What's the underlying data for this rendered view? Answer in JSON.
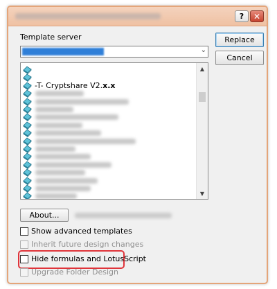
{
  "dialog": {
    "help_label": "?",
    "close_label": "✕",
    "template_server_label": "Template server",
    "replace_label": "Replace",
    "cancel_label": "Cancel",
    "about_label": "About...",
    "template_list": {
      "visible_item": "-T- Cryptshare V2.",
      "visible_item_suffix": "x.x",
      "selected_index": 2,
      "icon": "notes-database-book-icon"
    },
    "options": {
      "show_advanced_templates": {
        "label": "Show advanced templates",
        "checked": false,
        "enabled": true
      },
      "inherit_future_design": {
        "label": "Inherit future design changes",
        "checked": false,
        "enabled": false
      },
      "hide_formulas": {
        "label": "Hide formulas and LotusScript",
        "checked": false,
        "enabled": true
      },
      "upgrade_folder_design": {
        "label": "Upgrade Folder Design",
        "checked": false,
        "enabled": false
      }
    },
    "highlight_color": "#e0343a",
    "border_color": "#e4a57a"
  }
}
